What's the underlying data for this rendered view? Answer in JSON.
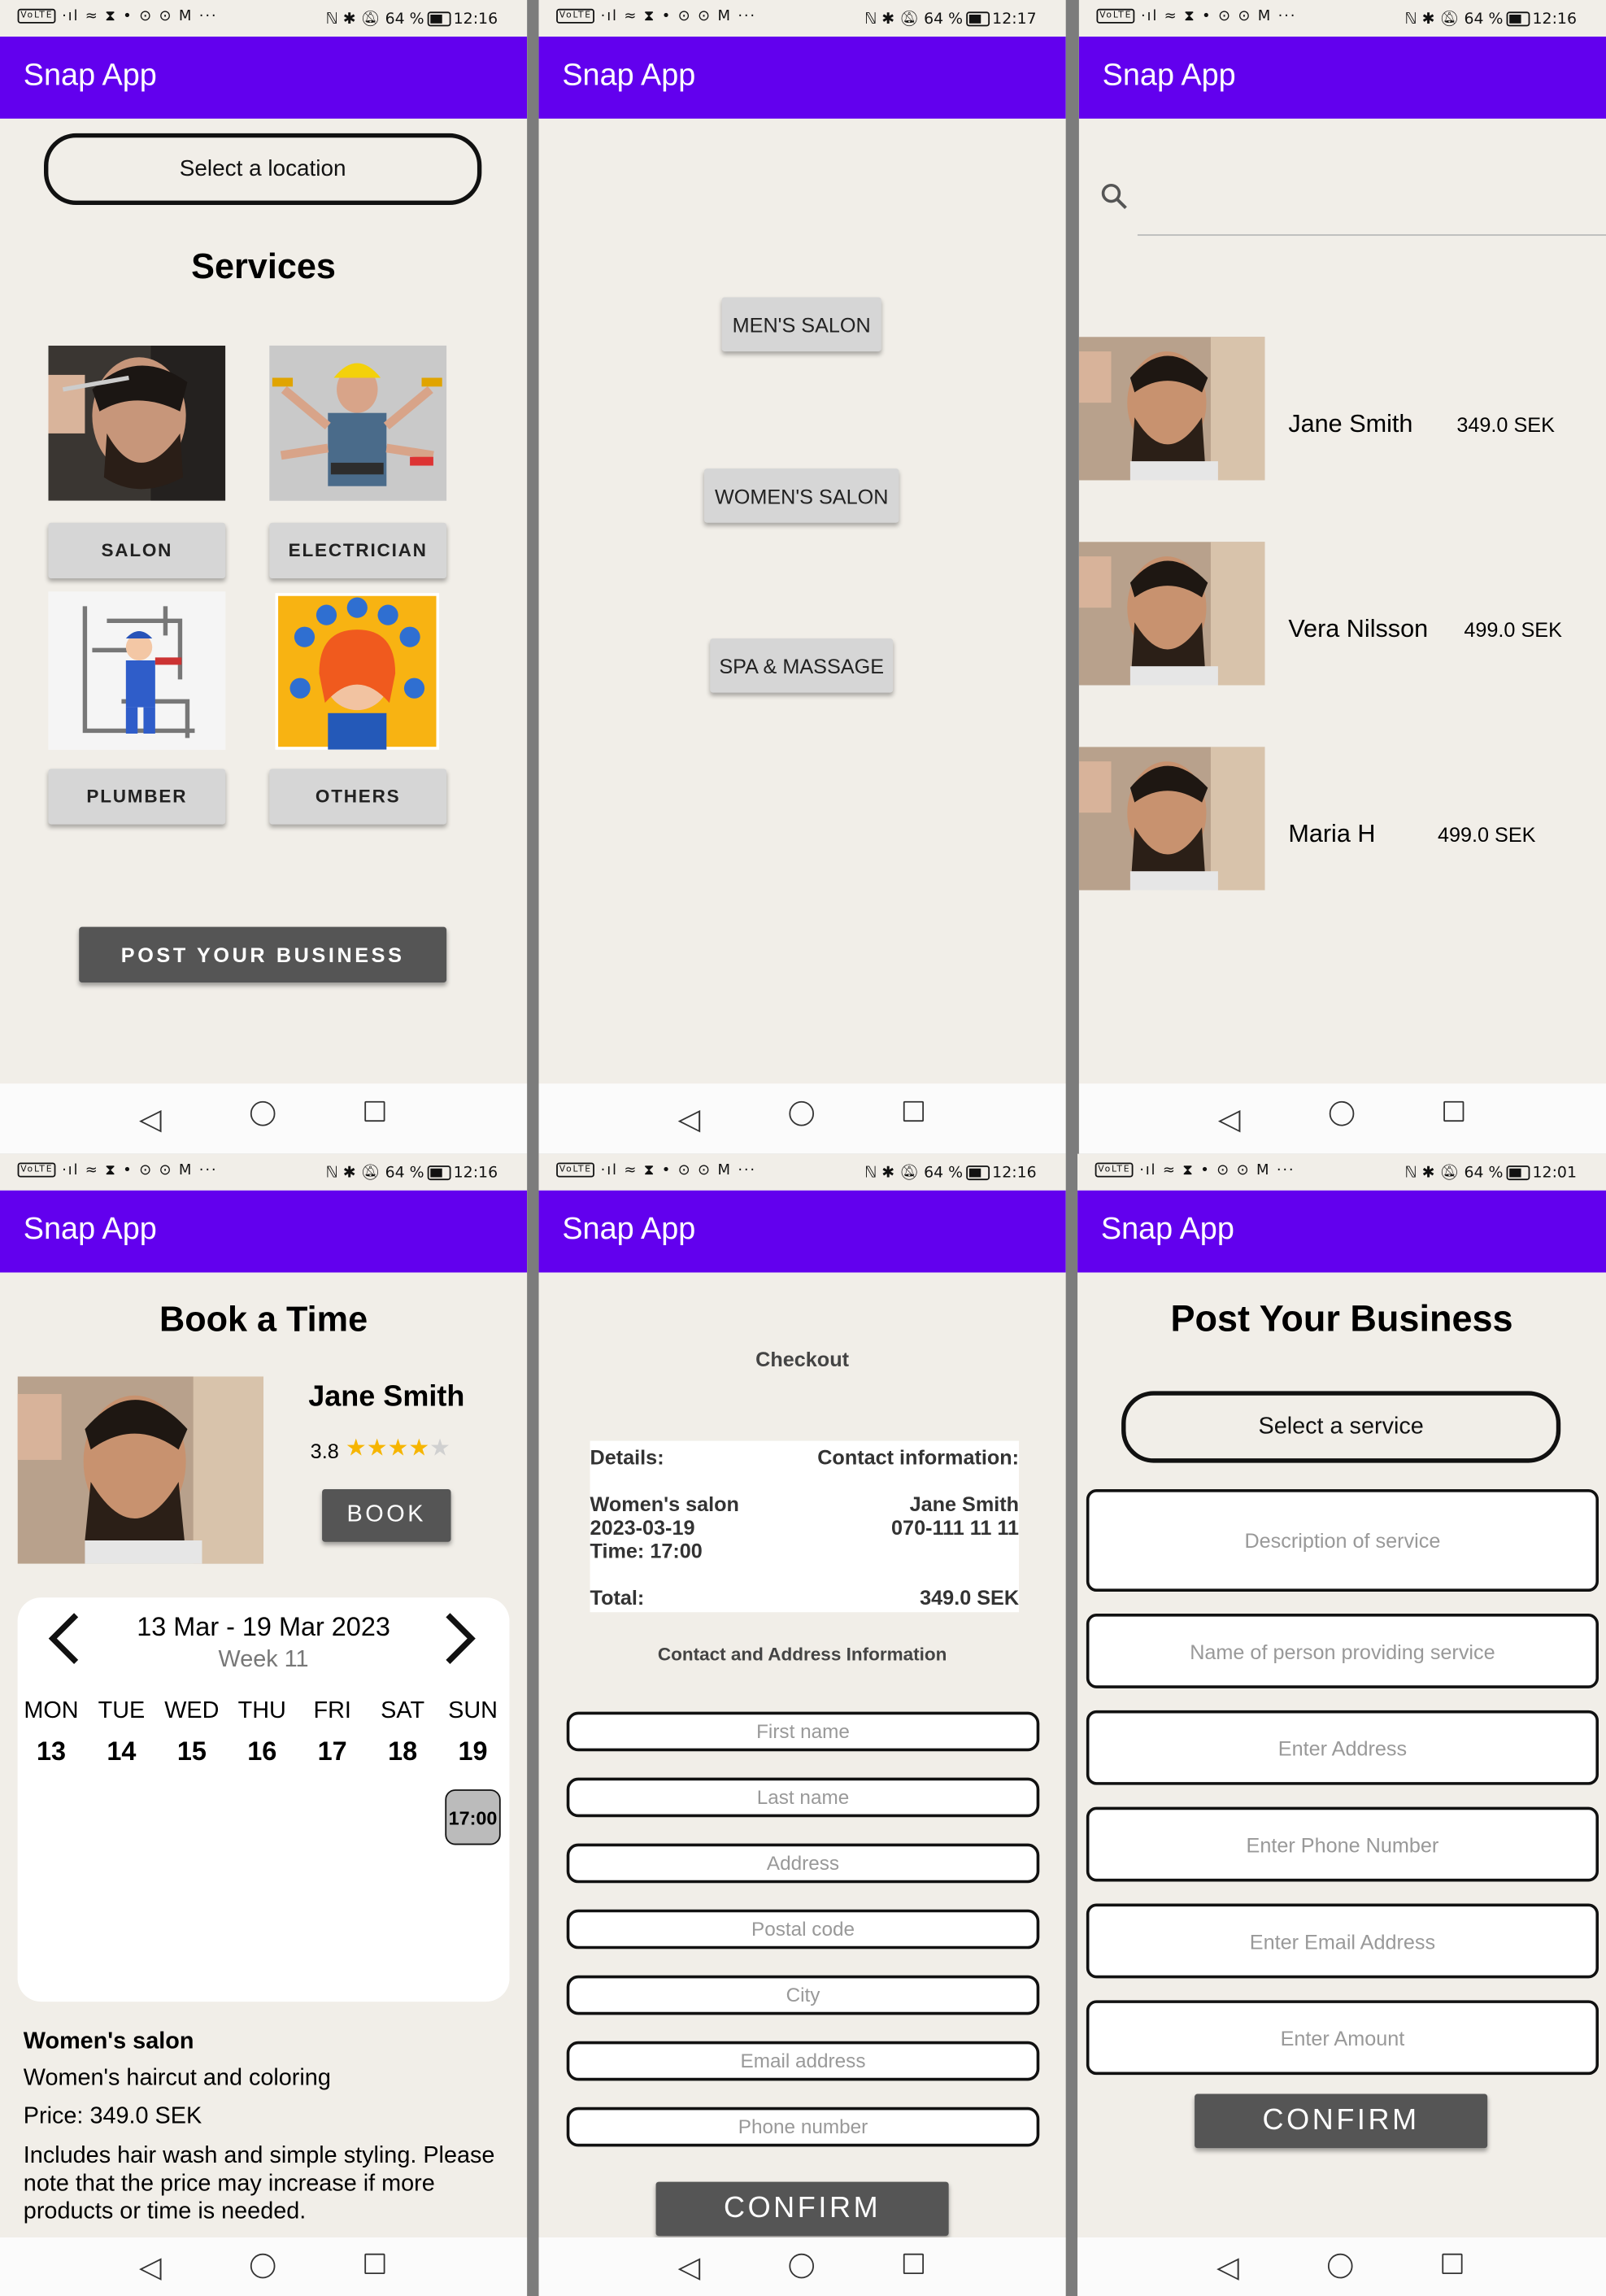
{
  "status": {
    "left_icons": "·ıl ≈ ⧗ • ⊙ ⊙ M ···",
    "battery": "64 %",
    "times": [
      "12:16",
      "12:17",
      "12:16",
      "12:16",
      "12:16",
      "12:01"
    ]
  },
  "app_title": "Snap App",
  "screen1": {
    "location": "Select a location",
    "heading": "Services",
    "services": [
      "SALON",
      "ELECTRICIAN",
      "PLUMBER",
      "OTHERS"
    ],
    "post_button": "POST YOUR BUSINESS"
  },
  "screen2": {
    "categories": [
      "MEN'S SALON",
      "WOMEN'S SALON",
      "SPA & MASSAGE"
    ]
  },
  "screen3": {
    "providers": [
      {
        "name": "Jane Smith",
        "price": "349.0 SEK"
      },
      {
        "name": "Vera Nilsson",
        "price": "499.0 SEK"
      },
      {
        "name": "Maria H",
        "price": "499.0 SEK"
      }
    ]
  },
  "screen4": {
    "heading": "Book a Time",
    "name": "Jane Smith",
    "rating": "3.8",
    "rating_value": 3.8,
    "book": "BOOK",
    "week_range": "13 Mar - 19 Mar 2023",
    "week_label": "Week 11",
    "days": [
      "MON",
      "TUE",
      "WED",
      "THU",
      "FRI",
      "SAT",
      "SUN"
    ],
    "dates": [
      "13",
      "14",
      "15",
      "16",
      "17",
      "18",
      "19"
    ],
    "slot": "17:00",
    "service_title": "Women's salon",
    "service_desc": "Women's haircut and coloring",
    "price": "Price: 349.0 SEK",
    "note": "Includes hair wash and simple styling. Please note that the price may increase if more products or time is needed."
  },
  "screen5": {
    "title": "Checkout",
    "details_label": "Details:",
    "contact_label": "Contact information:",
    "service": "Women's salon",
    "date": "2023-03-19",
    "time": "Time: 17:00",
    "contact_name": "Jane Smith",
    "contact_phone": "070-111 11 11",
    "total_label": "Total:",
    "total": "349.0 SEK",
    "address_heading": "Contact and Address Information",
    "fields": [
      "First name",
      "Last name",
      "Address",
      "Postal code",
      "City",
      "Email address",
      "Phone number"
    ],
    "confirm": "CONFIRM"
  },
  "screen6": {
    "heading": "Post Your Business",
    "select": "Select a service",
    "fields": [
      "Description of service",
      "Name of person providing service",
      "Enter Address",
      "Enter Phone Number",
      "Enter Email Address",
      "Enter Amount"
    ],
    "confirm": "CONFIRM"
  },
  "colors": {
    "app_bar": "#6200ee",
    "background": "#f1eee8",
    "dark_button": "#555555",
    "star": "#f6b500"
  }
}
